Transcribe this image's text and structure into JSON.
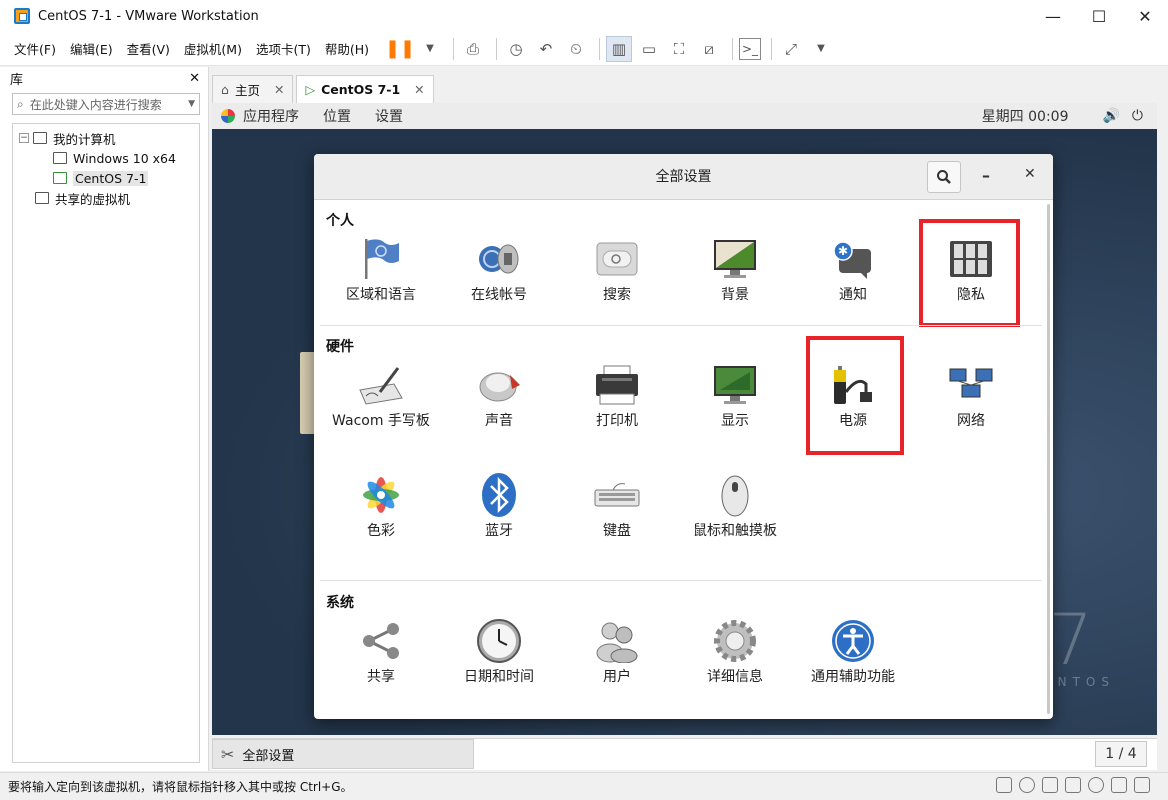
{
  "window": {
    "title": "CentOS 7-1 - VMware Workstation"
  },
  "menu": [
    "文件(F)",
    "编辑(E)",
    "查看(V)",
    "虚拟机(M)",
    "选项卡(T)",
    "帮助(H)"
  ],
  "library": {
    "title": "库",
    "search_placeholder": "在此处键入内容进行搜索",
    "tree": [
      "我的计算机",
      "Windows 10 x64",
      "CentOS 7-1",
      "共享的虚拟机"
    ]
  },
  "tabs": [
    "主页",
    "CentOS 7-1"
  ],
  "gnome": {
    "menus": [
      "应用程序",
      "位置",
      "设置"
    ],
    "clock": "星期四 00:09"
  },
  "settings": {
    "title": "全部设置",
    "sections": [
      {
        "title": "个人",
        "items": [
          "区域和语言",
          "在线帐号",
          "搜索",
          "背景",
          "通知",
          "隐私"
        ]
      },
      {
        "title": "硬件",
        "items": [
          "Wacom 手写板",
          "声音",
          "打印机",
          "显示",
          "电源",
          "网络",
          "色彩",
          "蓝牙",
          "键盘",
          "鼠标和触摸板"
        ]
      },
      {
        "title": "系统",
        "items": [
          "共享",
          "日期和时间",
          "用户",
          "详细信息",
          "通用辅助功能"
        ]
      }
    ]
  },
  "background": {
    "number": "7",
    "brand": "NTOS"
  },
  "taskbar": {
    "label": "全部设置",
    "pager": "1 / 4"
  },
  "status": {
    "text": "要将输入定向到该虚拟机，请将鼠标指针移入其中或按 Ctrl+G。"
  },
  "colors": {
    "highlight": "#e8232a",
    "accent": "#ff7a00"
  }
}
